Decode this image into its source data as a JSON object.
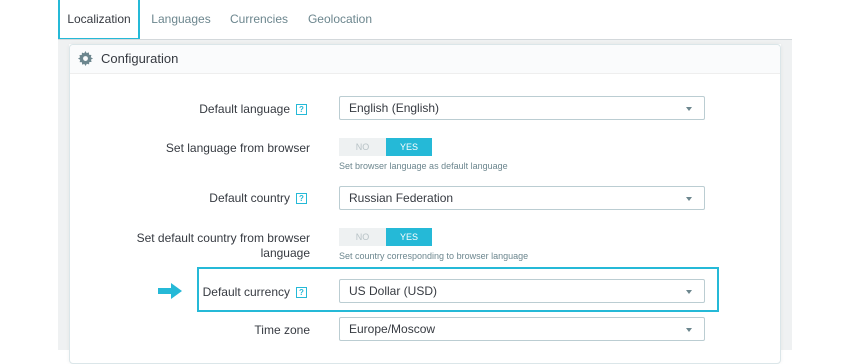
{
  "tabs": [
    {
      "label": "Localization",
      "active": true
    },
    {
      "label": "Languages",
      "active": false
    },
    {
      "label": "Currencies",
      "active": false
    },
    {
      "label": "Geolocation",
      "active": false
    }
  ],
  "panel": {
    "title": "Configuration",
    "icon": "gear-icon"
  },
  "help_glyph": "?",
  "fields": {
    "default_language": {
      "label": "Default language",
      "value": "English (English)"
    },
    "set_language_from_browser": {
      "label": "Set language from browser",
      "no": "NO",
      "yes": "YES",
      "selected": "YES",
      "hint": "Set browser language as default language"
    },
    "default_country": {
      "label": "Default country",
      "value": "Russian Federation"
    },
    "set_country_from_browser": {
      "label_line1": "Set default country from browser",
      "label_line2": "language",
      "no": "NO",
      "yes": "YES",
      "selected": "YES",
      "hint": "Set country corresponding to browser language"
    },
    "default_currency": {
      "label": "Default currency",
      "value": "US Dollar (USD)"
    },
    "time_zone": {
      "label": "Time zone",
      "value": "Europe/Moscow"
    }
  },
  "colors": {
    "accent": "#25b9d7",
    "text": "#363a41",
    "muted": "#6c868e"
  }
}
